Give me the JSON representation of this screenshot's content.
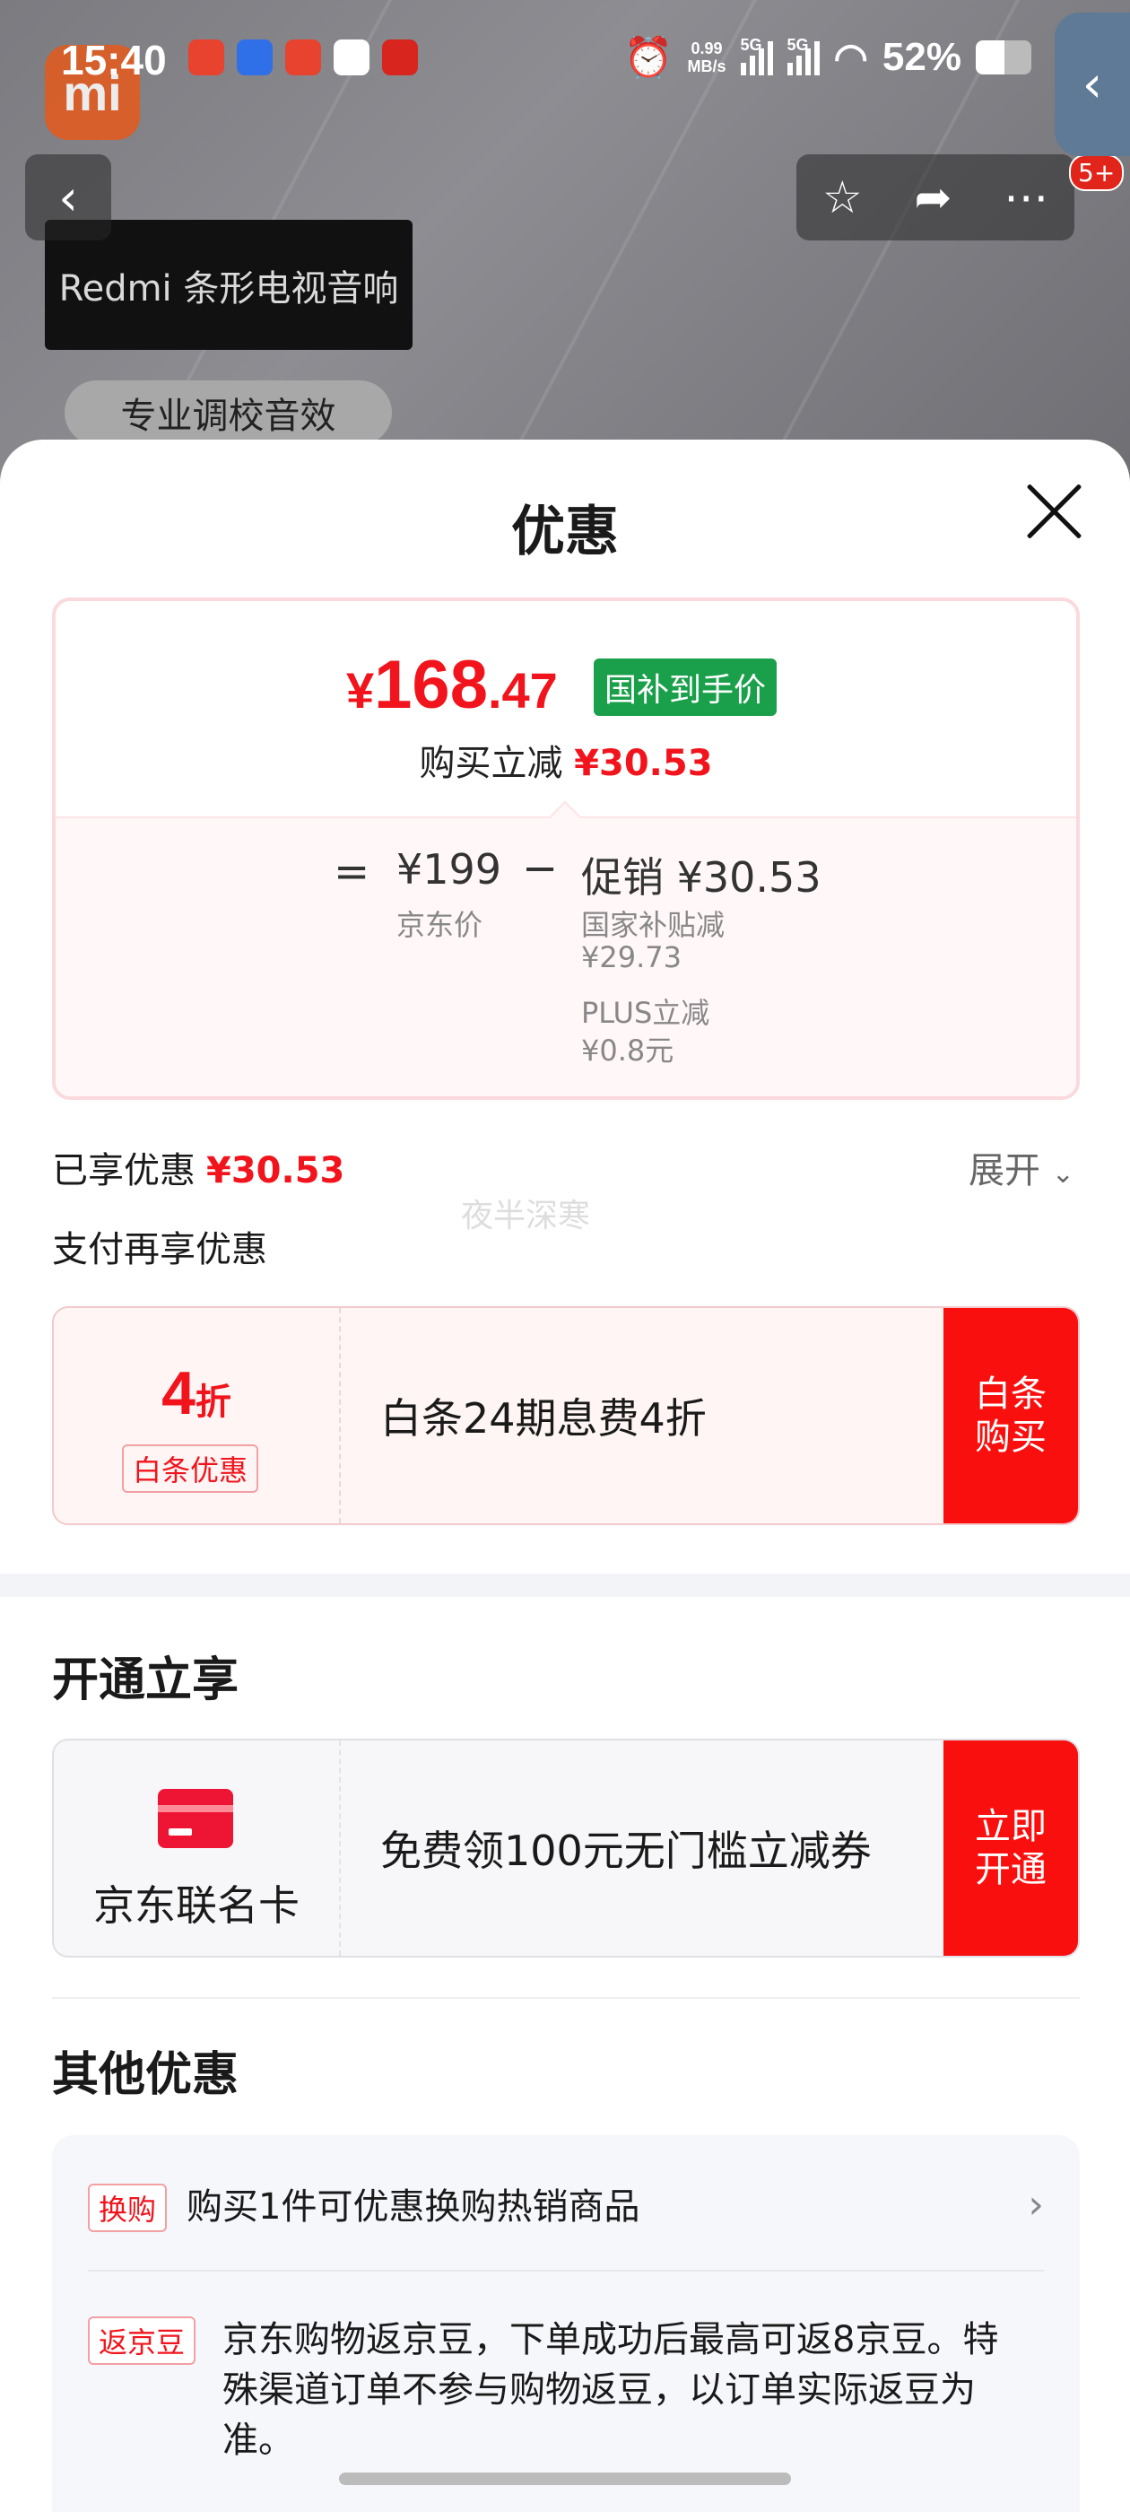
{
  "status_bar": {
    "time": "15:40",
    "net_speed_value": "0.99",
    "net_speed_unit": "MB/s",
    "sim1": "5G",
    "sim2": "5G",
    "battery": "52%"
  },
  "backdrop": {
    "promo_title": "Redmi 条形电视音响",
    "promo_tag": "专业调校音效",
    "cart_badge": "5+"
  },
  "sheet": {
    "title": "优惠"
  },
  "price_card": {
    "currency": "¥",
    "price_int": "168",
    "price_dec": ".47",
    "price_tag": "国补到手价",
    "sub_label": "购买立减",
    "sub_value": "¥30.53",
    "formula": {
      "equals": "=",
      "jd_price_value": "¥199",
      "jd_price_label": "京东价",
      "minus": "−",
      "promo_label": "促销",
      "promo_value": "¥30.53",
      "subsidy_label": "国家补贴减",
      "subsidy_value": "¥29.73",
      "plus_label": "PLUS立减",
      "plus_value": "¥0.8元"
    }
  },
  "enjoyed": {
    "label": "已享优惠",
    "value": "¥30.53",
    "expand": "展开",
    "watermark": "夜半深寒"
  },
  "pay_more": {
    "label": "支付再享优惠",
    "offer": {
      "discount_num": "4",
      "discount_unit": "折",
      "tag": "白条优惠",
      "text": "白条24期息费4折",
      "cta_line1": "白条",
      "cta_line2": "购买"
    }
  },
  "open_enjoy": {
    "title": "开通立享",
    "offer": {
      "card_name": "京东联名卡",
      "text": "免费领100元无门槛立减券",
      "cta_line1": "立即",
      "cta_line2": "开通"
    }
  },
  "other": {
    "title": "其他优惠",
    "items": [
      {
        "tag": "换购",
        "text": "购买1件可优惠换购热销商品"
      },
      {
        "tag": "返京豆",
        "text": "京东购物返京豆，下单成功后最高可返8京豆。特殊渠道订单不参与购物返豆，以订单实际返豆为准。"
      }
    ]
  },
  "colors": {
    "accent_red": "#f2141c",
    "cta_red": "#fa0f0f",
    "tag_green": "#1aa04a"
  }
}
